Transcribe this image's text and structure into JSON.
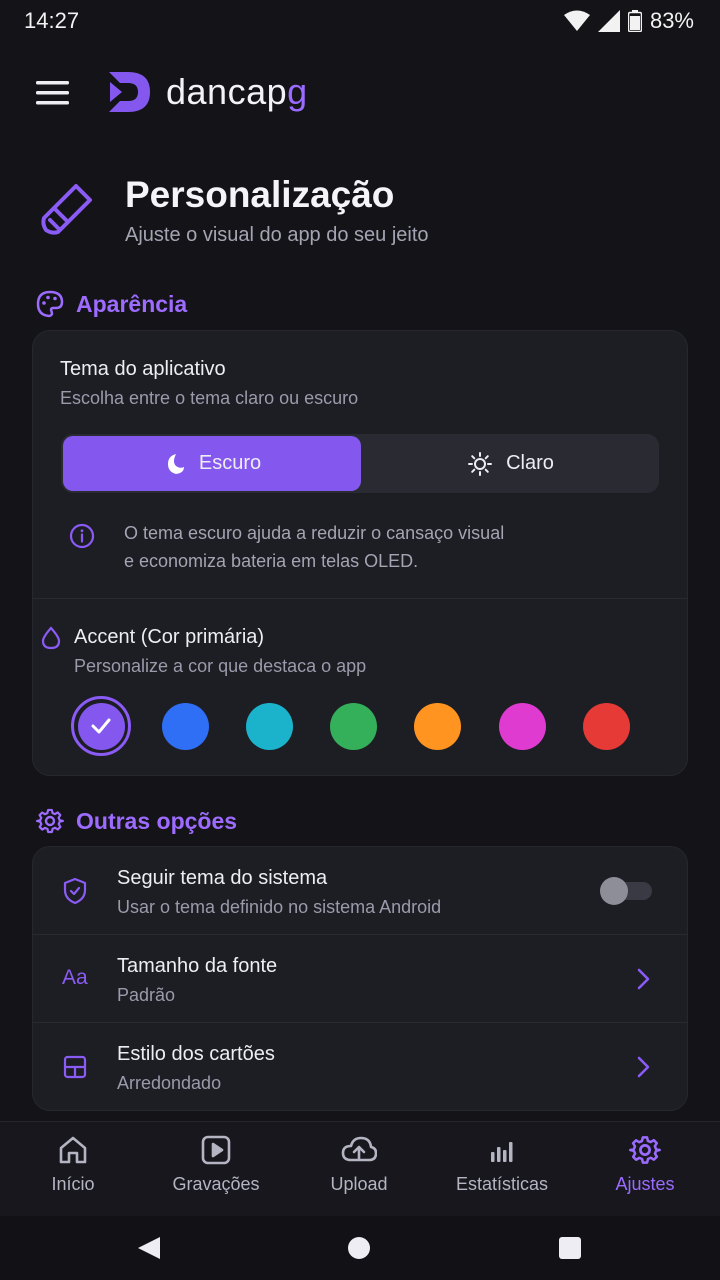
{
  "status_bar": {
    "time": "14:27",
    "battery": "83%"
  },
  "header": {
    "brand_main": "dancap",
    "brand_accent": "g"
  },
  "page": {
    "title": "Personalização",
    "subtitle": "Ajuste o visual do app do seu jeito"
  },
  "appearance": {
    "section_title": "Aparência",
    "theme_title": "Tema do aplicativo",
    "theme_subtitle": "Escolha entre o tema claro ou escuro",
    "dark_label": "Escuro",
    "light_label": "Claro",
    "selected_theme": "Escuro",
    "info_line1": "O tema escuro ajuda a reduzir o cansaço visual",
    "info_line2": "e economiza bateria em telas OLED.",
    "accent_title": "Accent (Cor primária)",
    "accent_subtitle": "Personalize a cor que destaca o app",
    "swatches": [
      "#8458EE",
      "#2F6FF5",
      "#1BB3CC",
      "#34B05A",
      "#FF9420",
      "#E03BD0",
      "#E53A35"
    ],
    "selected_swatch": "#8458EE"
  },
  "other": {
    "section_title": "Outras opções",
    "items": [
      {
        "title": "Seguir tema do sistema",
        "subtitle": "Usar o tema definido no sistema Android",
        "toggle_on": false
      },
      {
        "title": "Tamanho da fonte",
        "subtitle": "Padrão"
      },
      {
        "title": "Estilo dos cartões",
        "subtitle": "Arredondado"
      }
    ]
  },
  "bottom_nav": {
    "items": [
      {
        "label": "Início",
        "icon": "home-icon"
      },
      {
        "label": "Gravações",
        "icon": "play-icon"
      },
      {
        "label": "Upload",
        "icon": "cloud-upload-icon"
      },
      {
        "label": "Estatísticas",
        "icon": "bar-chart-icon"
      },
      {
        "label": "Ajustes",
        "icon": "gear-icon"
      }
    ],
    "active": "Ajustes"
  },
  "colors": {
    "accent": "#9B6BFF",
    "background": "#131318",
    "card": "#1D1D24"
  }
}
